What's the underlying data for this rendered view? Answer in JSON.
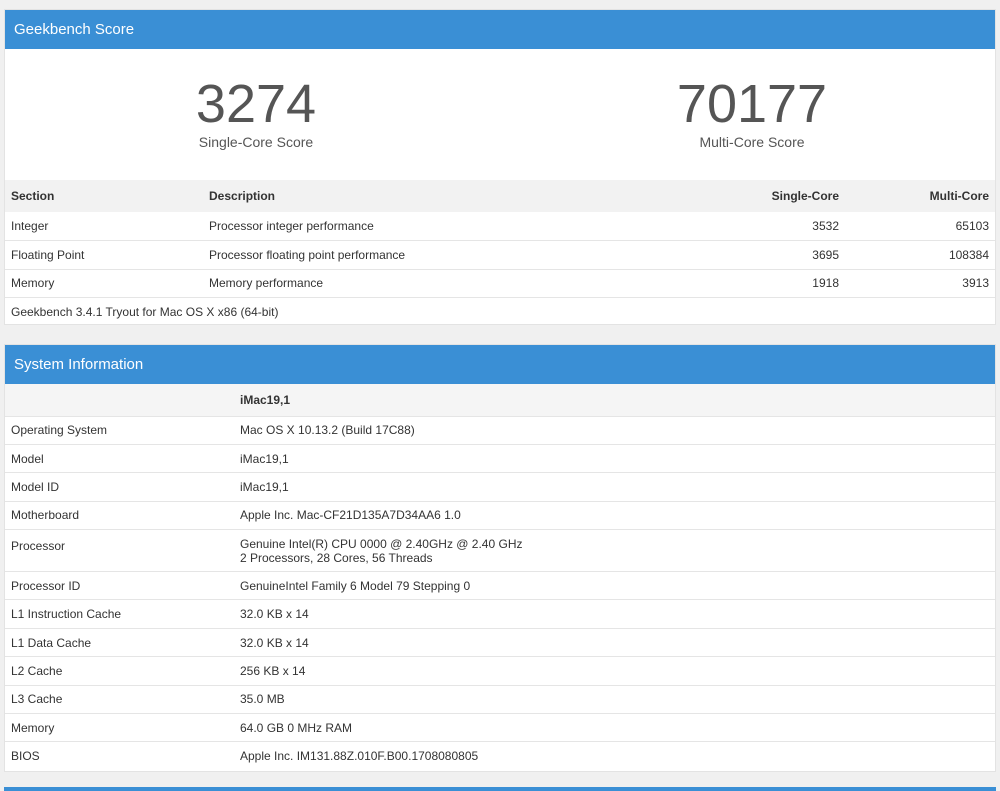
{
  "score_panel": {
    "title": "Geekbench Score",
    "single_core": {
      "value": "3274",
      "label": "Single-Core Score"
    },
    "multi_core": {
      "value": "70177",
      "label": "Multi-Core Score"
    },
    "table": {
      "headers": [
        "Section",
        "Description",
        "Single-Core",
        "Multi-Core"
      ],
      "rows": [
        {
          "section": "Integer",
          "description": "Processor integer performance",
          "single": "3532",
          "multi": "65103"
        },
        {
          "section": "Floating Point",
          "description": "Processor floating point performance",
          "single": "3695",
          "multi": "108384"
        },
        {
          "section": "Memory",
          "description": "Memory performance",
          "single": "1918",
          "multi": "3913"
        }
      ],
      "footer": "Geekbench 3.4.1 Tryout for Mac OS X x86 (64-bit)"
    }
  },
  "system_panel": {
    "title": "System Information",
    "header_value": "iMac19,1",
    "rows": [
      {
        "label": "Operating System",
        "value": "Mac OS X 10.13.2 (Build 17C88)"
      },
      {
        "label": "Model",
        "value": "iMac19,1"
      },
      {
        "label": "Model ID",
        "value": "iMac19,1"
      },
      {
        "label": "Motherboard",
        "value": "Apple Inc. Mac-CF21D135A7D34AA6 1.0"
      },
      {
        "label": "Processor",
        "value": "Genuine Intel(R) CPU 0000 @ 2.40GHz @ 2.40 GHz",
        "value2": "2 Processors, 28 Cores, 56 Threads"
      },
      {
        "label": "Processor ID",
        "value": "GenuineIntel Family 6 Model 79 Stepping 0"
      },
      {
        "label": "L1 Instruction Cache",
        "value": "32.0 KB x 14"
      },
      {
        "label": "L1 Data Cache",
        "value": "32.0 KB x 14"
      },
      {
        "label": "L2 Cache",
        "value": "256 KB x 14"
      },
      {
        "label": "L3 Cache",
        "value": "35.0 MB"
      },
      {
        "label": "Memory",
        "value": "64.0 GB 0 MHz RAM"
      },
      {
        "label": "BIOS",
        "value": "Apple Inc. IM131.88Z.010F.B00.1708080805"
      }
    ]
  },
  "colors": {
    "header_blue": "#3a8fd5"
  }
}
